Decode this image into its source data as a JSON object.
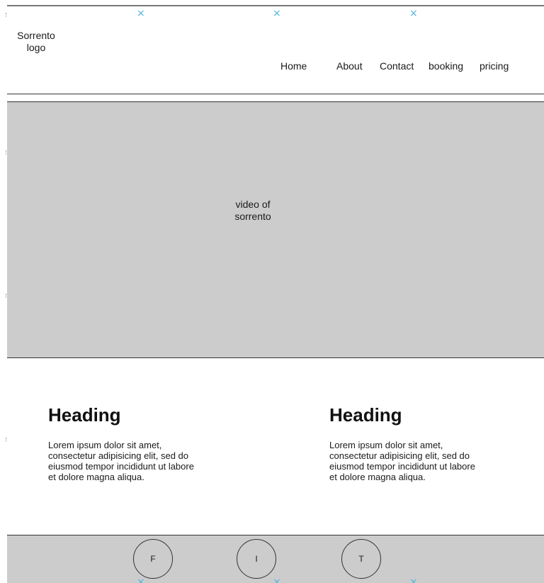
{
  "header": {
    "logo_text": "Sorrento\nlogo",
    "nav": [
      {
        "label": "Home"
      },
      {
        "label": "About"
      },
      {
        "label": "Contact"
      },
      {
        "label": "booking"
      },
      {
        "label": "pricing"
      }
    ]
  },
  "hero": {
    "placeholder_text": "video of\nsorrento"
  },
  "content": {
    "columns": [
      {
        "heading": "Heading",
        "text": "Lorem ipsum dolor sit amet, consectetur adipisicing elit, sed do eiusmod tempor incididunt ut labore et dolore magna aliqua."
      },
      {
        "heading": "Heading",
        "text": "Lorem ipsum dolor sit amet, consectetur adipisicing elit, sed do eiusmod tempor incididunt ut labore et dolore magna aliqua."
      }
    ]
  },
  "footer": {
    "social": [
      {
        "label": "F"
      },
      {
        "label": "I"
      },
      {
        "label": "T"
      }
    ]
  },
  "guides": {
    "mark_glyph": "×",
    "mark_color": "#4fb3e0"
  }
}
